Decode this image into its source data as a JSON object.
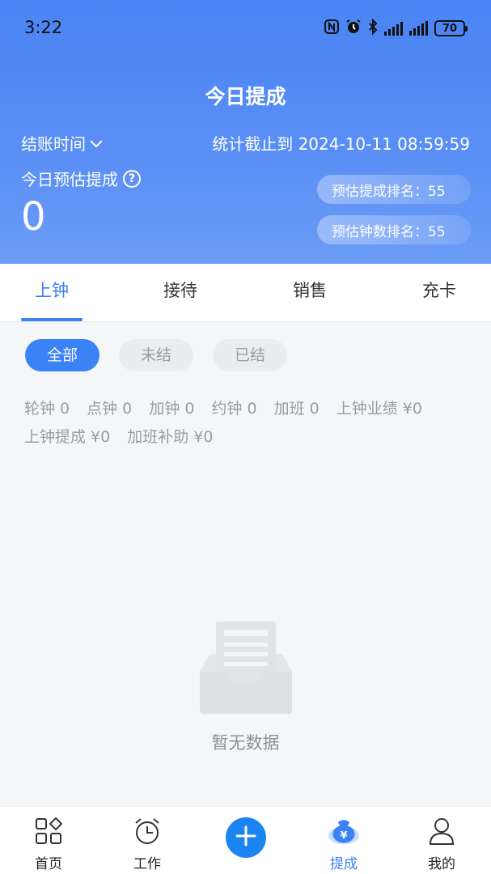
{
  "status_bar": {
    "time": "3:22",
    "battery": "70"
  },
  "header": {
    "title": "今日提成",
    "settle_time_label": "结账时间",
    "stat_deadline": "统计截止到 2024-10-11 08:59:59",
    "estimate_label": "今日预估提成",
    "estimate_value": "0",
    "rank_commission": "预估提成排名：55",
    "rank_clock": "预估钟数排名：55"
  },
  "tabs": [
    {
      "label": "上钟",
      "active": true
    },
    {
      "label": "接待",
      "active": false
    },
    {
      "label": "销售",
      "active": false
    },
    {
      "label": "充卡",
      "active": false
    }
  ],
  "filters": [
    {
      "label": "全部",
      "active": true
    },
    {
      "label": "未结",
      "active": false
    },
    {
      "label": "已结",
      "active": false
    }
  ],
  "stats": {
    "line1": [
      "轮钟 0",
      "点钟 0",
      "加钟 0",
      "约钟 0",
      "加班 0",
      "上钟业绩 ¥0"
    ],
    "line2": [
      "上钟提成 ¥0",
      "加班补助 ¥0"
    ]
  },
  "empty": {
    "text": "暂无数据",
    "icon": "empty-inbox-icon"
  },
  "bottom_nav": [
    {
      "label": "首页",
      "icon": "home-grid-icon",
      "active": false
    },
    {
      "label": "工作",
      "icon": "alarm-clock-icon",
      "active": false
    },
    {
      "label": "",
      "icon": "plus-icon",
      "active": false
    },
    {
      "label": "提成",
      "icon": "money-bag-icon",
      "active": true
    },
    {
      "label": "我的",
      "icon": "user-icon",
      "active": false
    }
  ],
  "colors": {
    "accent": "#3b82f6",
    "header_blue": "#4a84f4",
    "muted_text": "#9a9ca2"
  }
}
